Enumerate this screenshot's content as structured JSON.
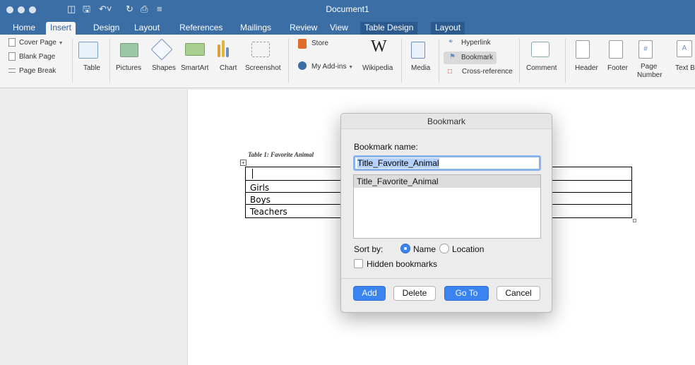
{
  "window": {
    "title": "Document1"
  },
  "tabs": [
    {
      "label": "Home"
    },
    {
      "label": "Insert"
    },
    {
      "label": "Design"
    },
    {
      "label": "Layout"
    },
    {
      "label": "References"
    },
    {
      "label": "Mailings"
    },
    {
      "label": "Review"
    },
    {
      "label": "View"
    },
    {
      "label": "Table Design"
    },
    {
      "label": "Layout"
    }
  ],
  "ribbon": {
    "pages": {
      "cover": "Cover Page",
      "blank": "Blank Page",
      "break": "Page Break"
    },
    "table": "Table",
    "pictures": "Pictures",
    "shapes": "Shapes",
    "smartart": "SmartArt",
    "chart": "Chart",
    "screenshot": "Screenshot",
    "store": "Store",
    "addins": "My Add-ins",
    "wikipedia": "Wikipedia",
    "wikipedia_glyph": "W",
    "media": "Media",
    "hyperlink": "Hyperlink",
    "bookmark": "Bookmark",
    "crossref": "Cross-reference",
    "comment": "Comment",
    "header": "Header",
    "footer": "Footer",
    "page_number_1": "Page",
    "page_number_2": "Number",
    "page_number_glyph": "#",
    "textbox": "Text B",
    "textbox_glyph": "A"
  },
  "document": {
    "caption": "Table 1: Favorite Animal",
    "rows": [
      "Girls",
      "Boys",
      "Teachers"
    ]
  },
  "dialog": {
    "title": "Bookmark",
    "name_label": "Bookmark name:",
    "name_value": "Title_Favorite_Animal",
    "bookmarks": [
      "Title_Favorite_Animal"
    ],
    "sort_by": "Sort by:",
    "sort_name": "Name",
    "sort_location": "Location",
    "hidden": "Hidden bookmarks",
    "buttons": {
      "add": "Add",
      "delete": "Delete",
      "goto": "Go To",
      "cancel": "Cancel"
    }
  },
  "colors": {
    "ribbon_blue": "#3c6ea6",
    "accent": "#3b84f0"
  }
}
